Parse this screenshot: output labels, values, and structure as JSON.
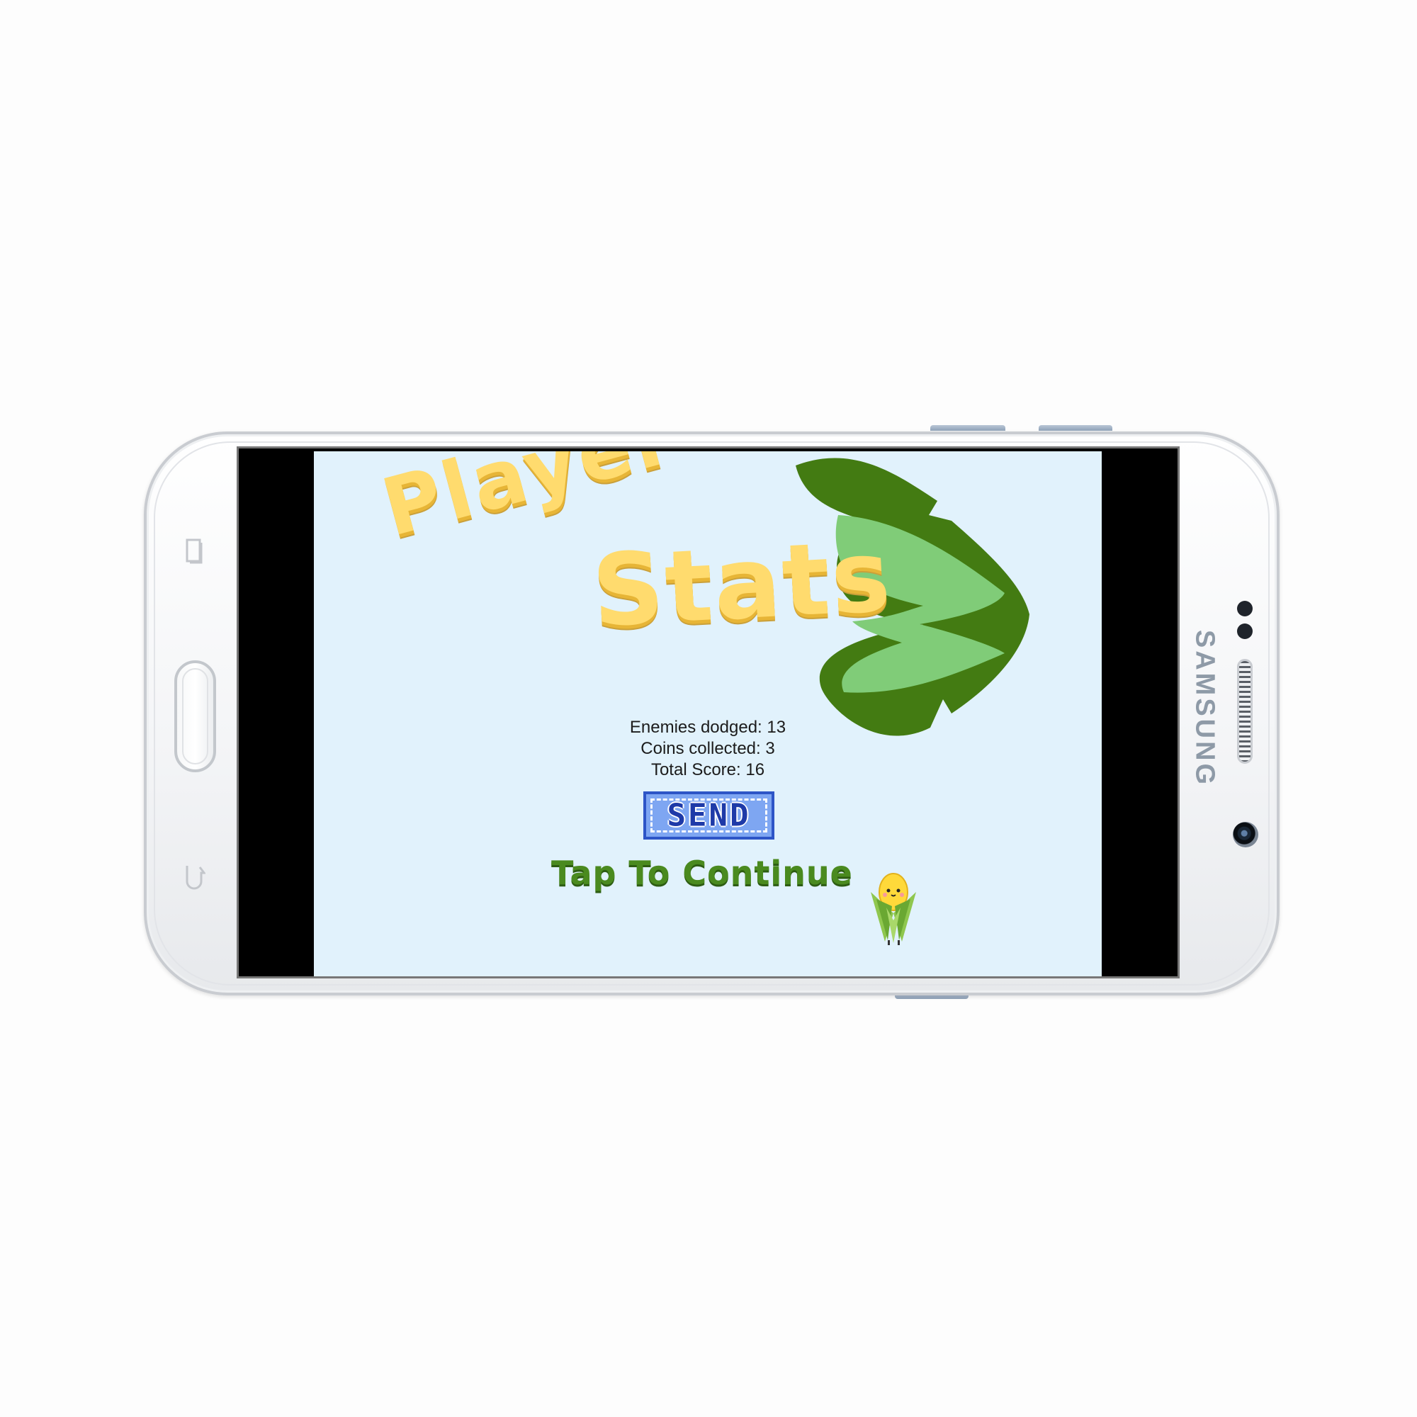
{
  "device": {
    "brand": "SAMSUNG"
  },
  "screen": {
    "background": "#e1f2fc",
    "title": {
      "line1": "Player",
      "line2": "Stats"
    },
    "stats": {
      "enemies_dodged": "Enemies dodged: 13",
      "coins_collected": "Coins collected: 3",
      "total_score": "Total Score: 16"
    },
    "send_button": {
      "label": "SEND"
    },
    "continue_prompt": "Tap To Continue"
  },
  "colors": {
    "title_yellow": "#ffdb6e",
    "leaf_dark": "#437b12",
    "leaf_light": "#80cc78",
    "send_fill": "#7ea6f2",
    "send_border": "#2d55c7",
    "continue_green": "#4a8a1f"
  },
  "icons": {
    "recent_apps": "recent-apps-icon",
    "back": "back-icon",
    "home": "home-button",
    "corn": "corn-mascot-icon",
    "leaf": "corn-husk-leaf-icon"
  }
}
